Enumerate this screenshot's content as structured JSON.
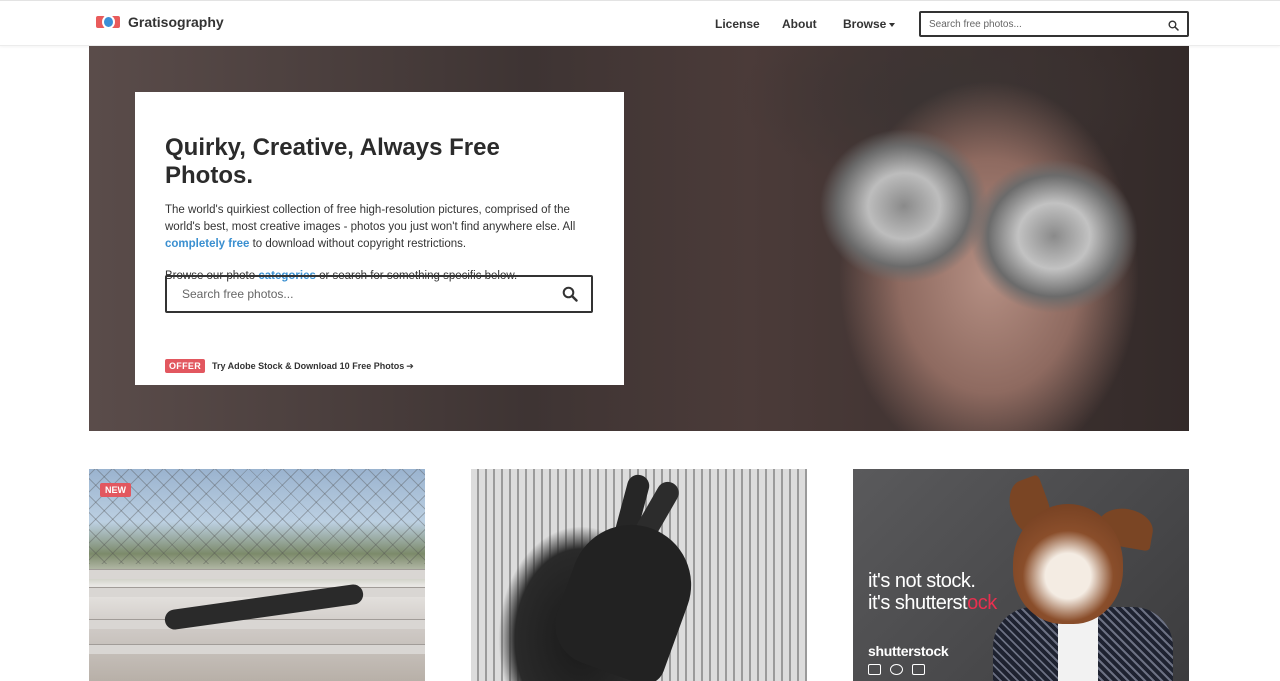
{
  "header": {
    "brand": "Gratisography",
    "nav": {
      "license": "License",
      "about": "About",
      "browse": "Browse"
    },
    "search_placeholder": "Search free photos..."
  },
  "hero": {
    "title": "Quirky, Creative, Always Free Photos.",
    "intro_text": "The world's quirkiest collection of free high-resolution pictures, comprised of the world's best, most creative images - photos you just won't find anywhere else. All",
    "free_link": "completely free",
    "intro_suffix": "to download without copyright restrictions.",
    "browse_prefix": "Browse our photo",
    "categories_link": "categories",
    "browse_suffix": "or search for something specific below.",
    "search_placeholder": "Search free photos...",
    "offer_badge": "OFFER",
    "offer_text": "Try Adobe Stock & Download 10 Free Photos"
  },
  "tiles": {
    "tile1_badge": "NEW",
    "ad_line1": "it's not stock.",
    "ad_line2_a": "it's shutterst",
    "ad_line2_b": "ock",
    "ad_brand": "shutterstock"
  },
  "colors": {
    "accent_link": "#3a8fd0",
    "badge_red": "#e2575f",
    "shutterstock_red": "#e8304f"
  },
  "icons": [
    "logo-icon",
    "search-icon",
    "chevron-down-icon",
    "arrow-right-icon",
    "camera-icon",
    "music-icon",
    "video-icon"
  ]
}
